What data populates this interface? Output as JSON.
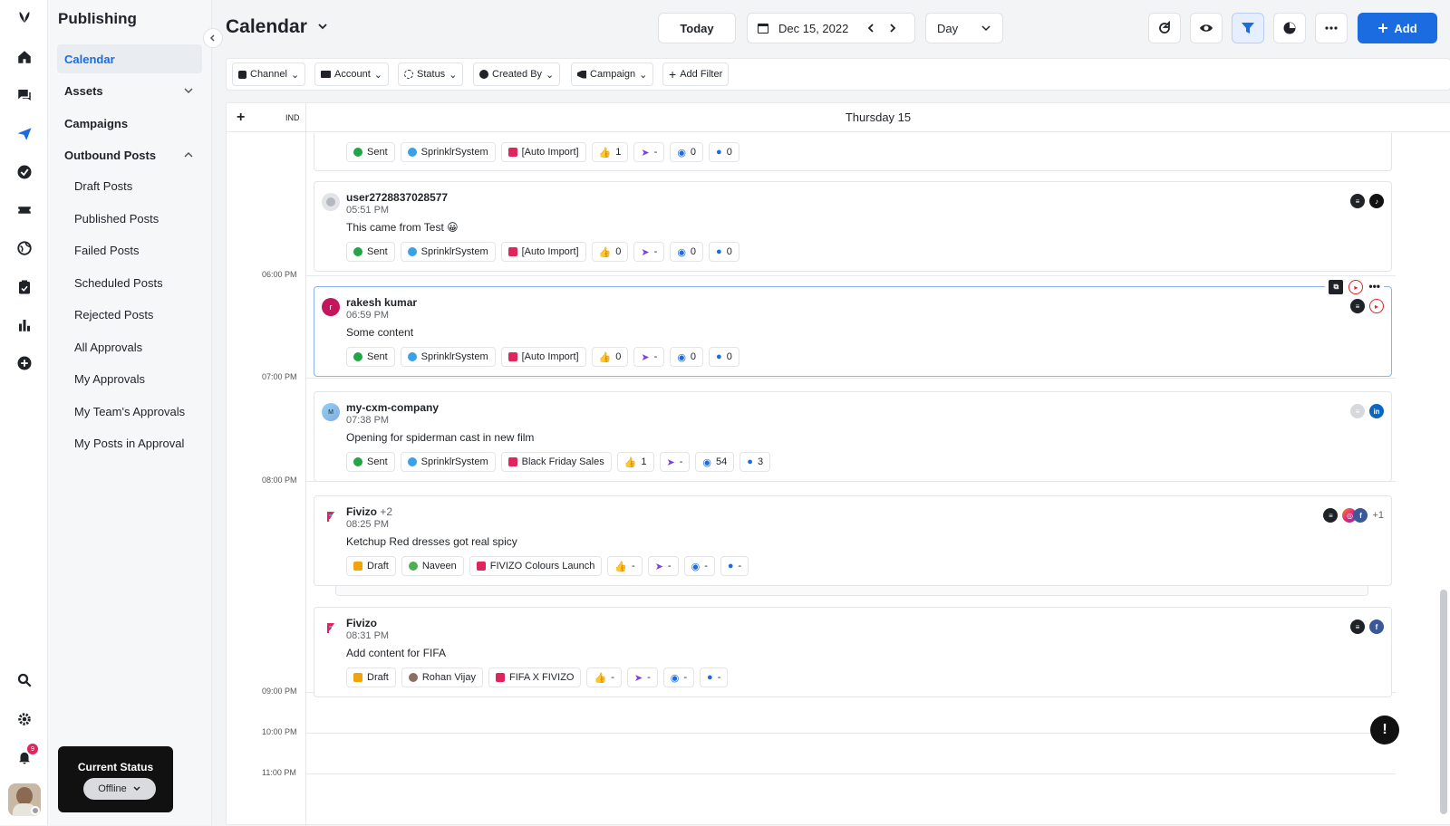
{
  "sidebar": {
    "title": "Publishing",
    "items": [
      {
        "label": "Calendar"
      },
      {
        "label": "Assets"
      },
      {
        "label": "Campaigns"
      },
      {
        "label": "Outbound Posts"
      }
    ],
    "sub_items": [
      "Draft Posts",
      "Published Posts",
      "Failed Posts",
      "Scheduled Posts",
      "Rejected Posts",
      "All Approvals",
      "My Approvals",
      "My Team's Approvals",
      "My Posts in Approval"
    ],
    "status_title": "Current Status",
    "status_value": "Offline",
    "notif_count": "9"
  },
  "header": {
    "title": "Calendar",
    "today": "Today",
    "date": "Dec 15, 2022",
    "view": "Day",
    "add": "Add"
  },
  "filters": [
    "Channel",
    "Account",
    "Status",
    "Created By",
    "Campaign",
    "Add Filter"
  ],
  "board": {
    "add_col": "+",
    "ind_col": "IND",
    "day": "Thursday 15",
    "times": [
      "06:00 PM",
      "07:00 PM",
      "08:00 PM",
      "09:00 PM",
      "10:00 PM",
      "11:00 PM"
    ]
  },
  "posts": [
    {
      "name": "",
      "time": "",
      "msg": "",
      "status": "Sent",
      "user": "SprinklrSystem",
      "campaign": "[Auto Import]",
      "likes": "1",
      "shares": "-",
      "views": "0",
      "comments": "0"
    },
    {
      "name": "user2728837028577",
      "time": "05:51 PM",
      "msg": "This came from Test 😀",
      "status": "Sent",
      "user": "SprinklrSystem",
      "campaign": "[Auto Import]",
      "likes": "0",
      "shares": "-",
      "views": "0",
      "comments": "0"
    },
    {
      "name": "rakesh kumar",
      "time": "06:59 PM",
      "msg": "Some content",
      "status": "Sent",
      "user": "SprinklrSystem",
      "campaign": "[Auto Import]",
      "likes": "0",
      "shares": "-",
      "views": "0",
      "comments": "0",
      "avatar": "r"
    },
    {
      "name": "my-cxm-company",
      "time": "07:38 PM",
      "msg": "Opening for spiderman cast in new film",
      "status": "Sent",
      "user": "SprinklrSystem",
      "campaign": "Black Friday Sales",
      "likes": "1",
      "shares": "-",
      "views": "54",
      "comments": "3",
      "avatar": "M"
    },
    {
      "name": "Fivizo",
      "extra": "+2",
      "time": "08:25 PM",
      "msg": "Ketchup Red dresses got real spicy",
      "status": "Draft",
      "user": "Naveen",
      "campaign": "FIVIZO Colours Launch",
      "likes": "-",
      "shares": "-",
      "views": "-",
      "comments": "-",
      "more": "+1"
    },
    {
      "name": "Fivizo",
      "time": "08:31 PM",
      "msg": "Add content for FIFA",
      "status": "Draft",
      "user": "Rohan Vijay",
      "campaign": "FIFA X FIVIZO",
      "likes": "-",
      "shares": "-",
      "views": "-",
      "comments": "-"
    }
  ],
  "colors": {
    "accent": "#1b6ce0",
    "sent": "#22a447",
    "draft": "#f0a30a",
    "campaign": "#e0245e",
    "share": "#7b3fe4"
  }
}
